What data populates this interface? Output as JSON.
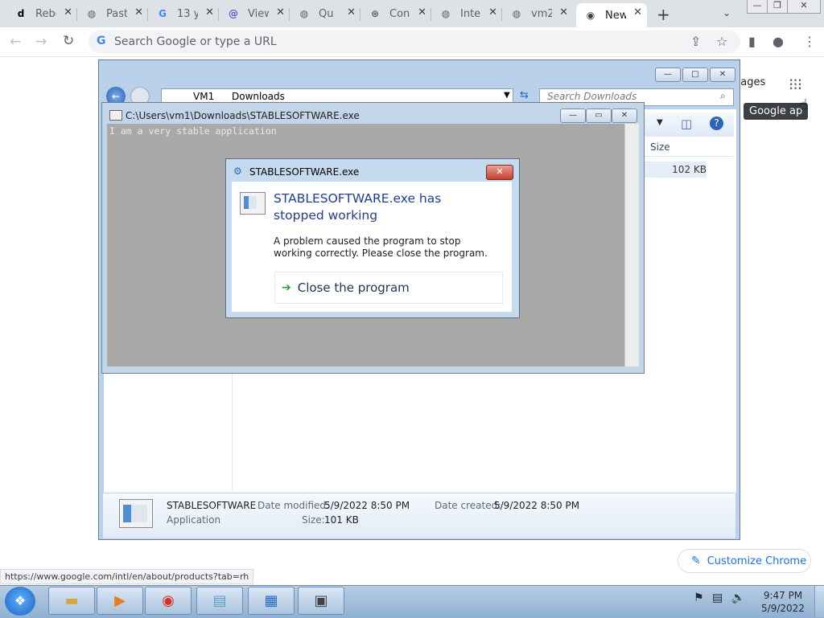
{
  "browser": {
    "tabs": [
      {
        "label": "Rebe",
        "favicon": "d"
      },
      {
        "label": "Past",
        "favicon": "globe-icon"
      },
      {
        "label": "13 y",
        "favicon": "G"
      },
      {
        "label": "View",
        "favicon": "@"
      },
      {
        "label": "Qu",
        "favicon": "globe-icon"
      },
      {
        "label": "Con",
        "favicon": "github-icon"
      },
      {
        "label": "Inte",
        "favicon": "globe-icon"
      },
      {
        "label": "vm2",
        "favicon": "globe-icon"
      },
      {
        "label": "New",
        "favicon": "chrome-icon",
        "active": true
      }
    ],
    "omnibox_placeholder": "Search Google or type a URL",
    "status_url": "https://www.google.com/intl/en/about/products?tab=rh",
    "page": {
      "images_link": "nages",
      "apps_tooltip": "Google ap",
      "customize_label": "Customize Chrome"
    }
  },
  "explorer": {
    "breadcrumb": [
      "VM1",
      "Downloads"
    ],
    "search_placeholder": "Search Downloads",
    "column_size": "Size",
    "file_size": "102 KB",
    "details": {
      "name": "STABLESOFTWARE",
      "type": "Application",
      "date_modified_label": "Date modified:",
      "date_modified": "5/9/2022 8:50 PM",
      "date_created_label": "Date created:",
      "date_created": "5/9/2022 8:50 PM",
      "size_label": "Size:",
      "size": "101 KB"
    }
  },
  "console": {
    "title": "C:\\Users\\vm1\\Downloads\\STABLESOFTWARE.exe",
    "output": "I am a very stable application"
  },
  "dialog": {
    "title": "STABLESOFTWARE.exe",
    "heading": "STABLESOFTWARE.exe has stopped working",
    "message": "A problem caused the program to stop working correctly. Please close the program.",
    "button": "Close the program"
  },
  "taskbar": {
    "time": "9:47 PM",
    "date": "5/9/2022"
  }
}
